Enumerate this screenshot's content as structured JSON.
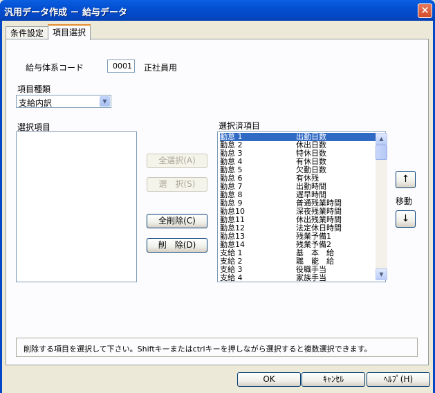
{
  "window": {
    "title": "汎用データ作成 － 給与データ"
  },
  "tabs": [
    {
      "label": "条件設定"
    },
    {
      "label": "項目選択"
    }
  ],
  "form": {
    "pay_code_label": "給与体系コード",
    "pay_code_value": "0001",
    "pay_code_name": "正社員用",
    "item_type_label": "項目種類",
    "item_type_value": "支給内訳",
    "available_label": "選択項目",
    "selected_label": "選択済項目",
    "move_label": "移動"
  },
  "buttons": {
    "select_all": "全選択(A)",
    "select": "選　択(S)",
    "delete_all": "全削除(C)",
    "delete": "削　除(D)",
    "up": "↑",
    "down": "↓",
    "ok": "OK",
    "cancel": "ｷｬﾝｾﾙ",
    "help": "ﾍﾙﾌﾟ(H)"
  },
  "icons": {
    "close": "close-icon",
    "dropdown": "chevron-down-icon",
    "scroll_up": "chevron-up-icon",
    "scroll_down": "chevron-down-icon"
  },
  "selected_items": [
    {
      "code": "勤怠 1",
      "name": "出勤日数"
    },
    {
      "code": "勤怠 2",
      "name": "休出日数"
    },
    {
      "code": "勤怠 3",
      "name": "特休日数"
    },
    {
      "code": "勤怠 4",
      "name": "有休日数"
    },
    {
      "code": "勤怠 5",
      "name": "欠勤日数"
    },
    {
      "code": "勤怠 6",
      "name": "有休残"
    },
    {
      "code": "勤怠 7",
      "name": "出勤時間"
    },
    {
      "code": "勤怠 8",
      "name": "遅早時間"
    },
    {
      "code": "勤怠 9",
      "name": "普通残業時間"
    },
    {
      "code": "勤怠10",
      "name": "深夜残業時間"
    },
    {
      "code": "勤怠11",
      "name": "休出残業時間"
    },
    {
      "code": "勤怠12",
      "name": "法定休日時間"
    },
    {
      "code": "勤怠13",
      "name": "残業予備1"
    },
    {
      "code": "勤怠14",
      "name": "残業予備2"
    },
    {
      "code": "支給 1",
      "name": "基　本　給"
    },
    {
      "code": "支給 2",
      "name": "職　能　給"
    },
    {
      "code": "支給 3",
      "name": "役職手当"
    },
    {
      "code": "支給 4",
      "name": "家族手当"
    }
  ],
  "status_text": "削除する項目を選択して下さい。Shiftキーまたはctrlキーを押しながら選択すると複数選択できます。"
}
